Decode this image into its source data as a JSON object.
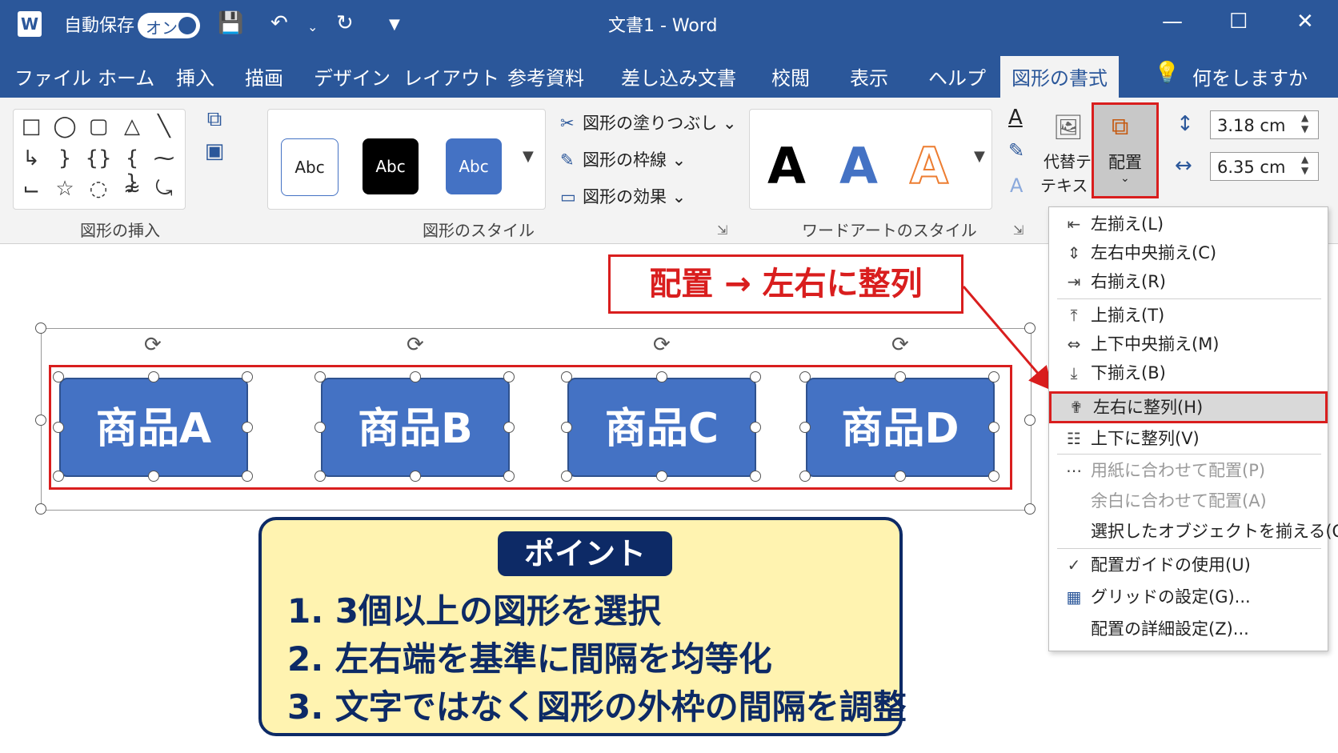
{
  "app": {
    "autosave_label": "自動保存",
    "autosave_state": "オン",
    "document_title": "文書1  -  Word"
  },
  "tabs": [
    {
      "label": "ファイル"
    },
    {
      "label": "ホーム"
    },
    {
      "label": "挿入"
    },
    {
      "label": "描画"
    },
    {
      "label": "デザイン"
    },
    {
      "label": "レイアウト"
    },
    {
      "label": "参考資料"
    },
    {
      "label": "差し込み文書"
    },
    {
      "label": "校閲"
    },
    {
      "label": "表示"
    },
    {
      "label": "ヘルプ"
    },
    {
      "label": "図形の書式",
      "active": true
    },
    {
      "label": "何をしますか"
    }
  ],
  "ribbon": {
    "group_insert_shapes": "図形の挿入",
    "group_shape_styles": "図形のスタイル",
    "group_wordart": "ワードアートのスタイル",
    "style_sample": "Abc",
    "fill": "図形の塗りつぶし",
    "outline": "図形の枠線",
    "effects": "図形の効果",
    "wordart_letter": "A",
    "alt_text_line1": "代替テ",
    "alt_text_line2": "テキスト",
    "arrange": "配置",
    "height": "3.18 cm",
    "width": "6.35 cm"
  },
  "menu": {
    "items": [
      {
        "label": "左揃え(L)",
        "icon": "align-left-icon"
      },
      {
        "label": "左右中央揃え(C)",
        "icon": "align-center-icon"
      },
      {
        "label": "右揃え(R)",
        "icon": "align-right-icon"
      },
      {
        "label": "上揃え(T)",
        "icon": "align-top-icon"
      },
      {
        "label": "上下中央揃え(M)",
        "icon": "align-middle-icon"
      },
      {
        "label": "下揃え(B)",
        "icon": "align-bottom-icon"
      },
      {
        "label": "左右に整列(H)",
        "icon": "distribute-horizontal-icon",
        "highlighted": true
      },
      {
        "label": "上下に整列(V)",
        "icon": "distribute-vertical-icon"
      },
      {
        "label": "用紙に合わせて配置(P)",
        "disabled": true
      },
      {
        "label": "余白に合わせて配置(A)",
        "disabled": true
      },
      {
        "label": "選択したオブジェクトを揃える(O)"
      },
      {
        "label": "配置ガイドの使用(U)",
        "icon": "checkmark-icon",
        "checked": true
      },
      {
        "label": "グリッドの設定(G)...",
        "icon": "grid-icon"
      },
      {
        "label": "配置の詳細設定(Z)..."
      }
    ]
  },
  "callout": "配置 → 左右に整列",
  "shapes": [
    "商品A",
    "商品B",
    "商品C",
    "商品D"
  ],
  "point": {
    "title": "ポイント",
    "lines": [
      "1. 3個以上の図形を選択",
      "2. 左右端を基準に間隔を均等化",
      "3. 文字ではなく図形の外枠の間隔を調整"
    ]
  },
  "colors": {
    "titlebar": "#2b579a",
    "shape_fill": "#4472c4",
    "highlight_red": "#d91e1e",
    "point_bg": "#fff3b0",
    "point_border": "#0d2a66"
  }
}
